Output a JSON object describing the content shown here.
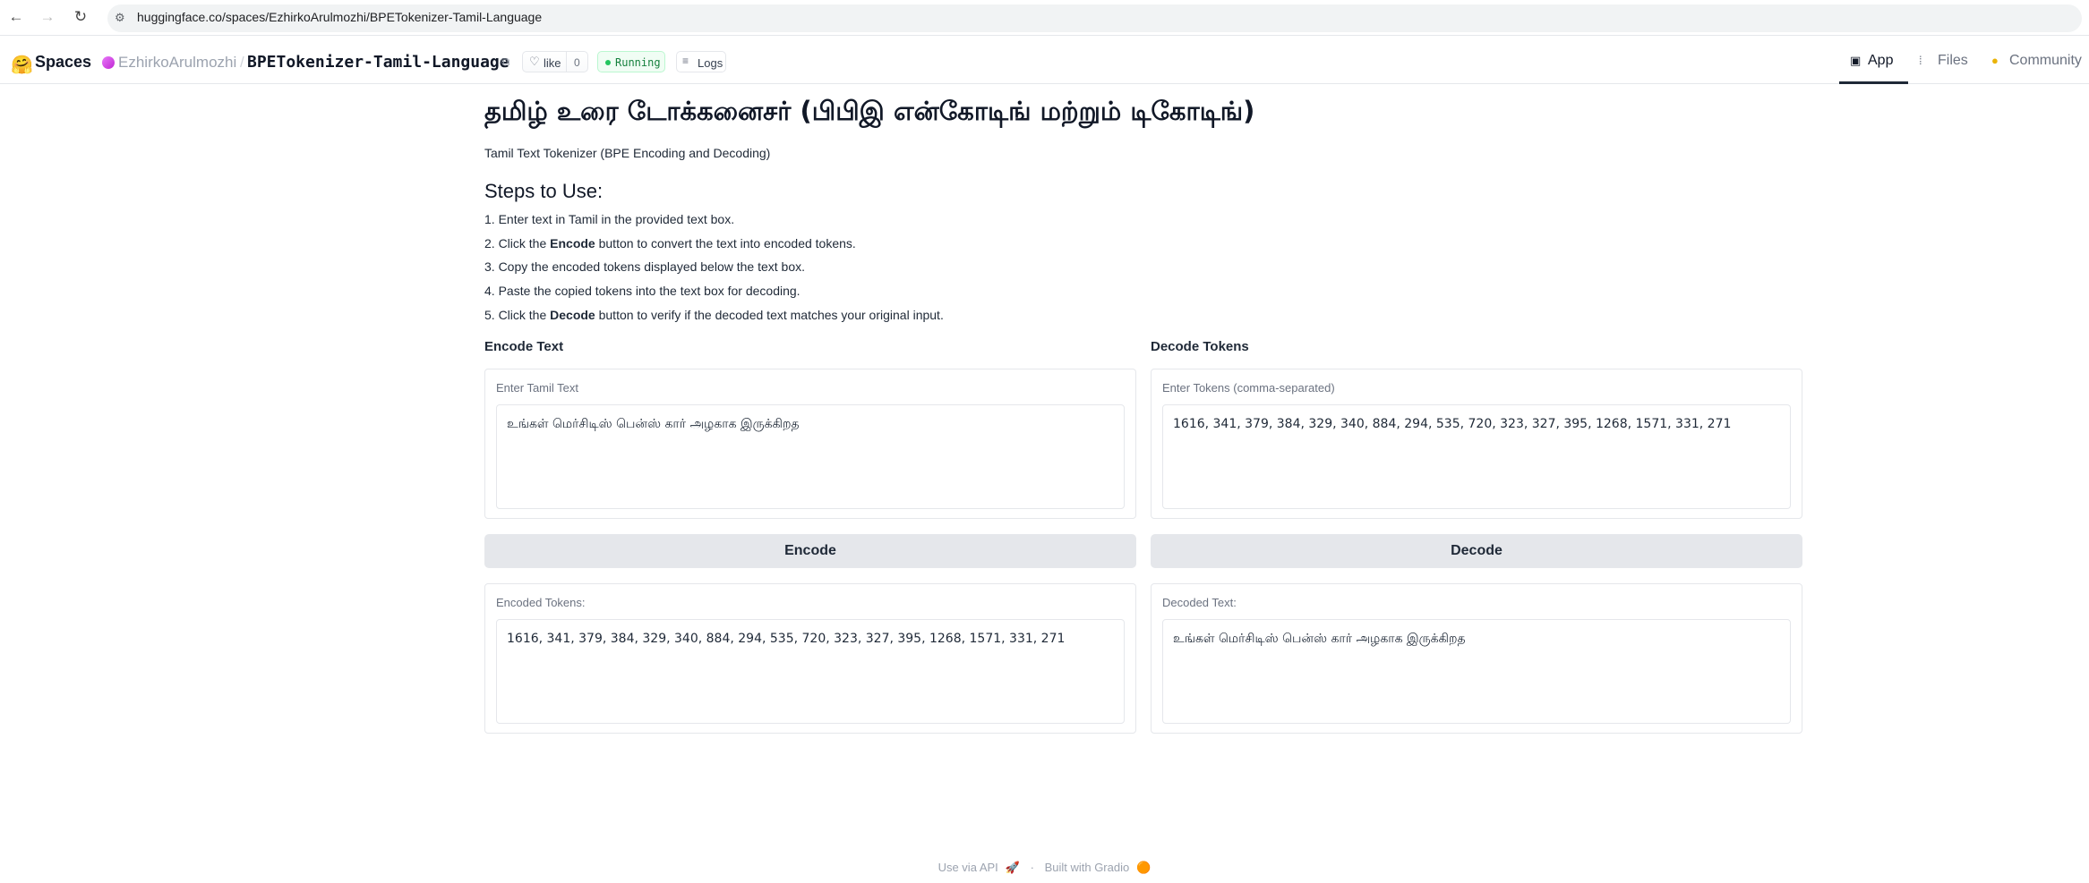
{
  "browser": {
    "url": "huggingface.co/spaces/EzhirkoArulmozhi/BPETokenizer-Tamil-Language"
  },
  "header": {
    "spaces_label": "Spaces",
    "user": "EzhirkoArulmozhi",
    "separator": "/",
    "repo": "BPETokenizer-Tamil-Language",
    "like_label": "like",
    "like_count": "0",
    "status": "Running",
    "logs_label": "Logs",
    "tabs": [
      {
        "label": "App"
      },
      {
        "label": "Files"
      },
      {
        "label": "Community"
      }
    ]
  },
  "main": {
    "title": "தமிழ் உரை டோக்கனைசர் (பிபிஇ என்கோடிங் மற்றும் டிகோடிங்)",
    "subtitle": "Tamil Text Tokenizer (BPE Encoding and Decoding)",
    "steps_heading": "Steps to Use:",
    "steps": [
      {
        "prefix": "1. Enter text in Tamil in the provided text box.",
        "bold": "",
        "suffix": ""
      },
      {
        "prefix": "2. Click the ",
        "bold": "Encode",
        "suffix": " button to convert the text into encoded tokens."
      },
      {
        "prefix": "3. Copy the encoded tokens displayed below the text box.",
        "bold": "",
        "suffix": ""
      },
      {
        "prefix": "4. Paste the copied tokens into the text box for decoding.",
        "bold": "",
        "suffix": ""
      },
      {
        "prefix": "5. Click the ",
        "bold": "Decode",
        "suffix": " button to verify if the decoded text matches your original input."
      }
    ]
  },
  "encode": {
    "section_label": "Encode Text",
    "input_label": "Enter Tamil Text",
    "input_value": "உங்கள் மெர்சிடிஸ் பென்ஸ் கார் அழகாக இருக்கிறத",
    "button_label": "Encode",
    "output_label": "Encoded Tokens:",
    "output_value": "1616, 341, 379, 384, 329, 340, 884, 294, 535, 720, 323, 327, 395, 1268, 1571, 331, 271"
  },
  "decode": {
    "section_label": "Decode Tokens",
    "input_label": "Enter Tokens (comma-separated)",
    "input_value": "1616, 341, 379, 384, 329, 340, 884, 294, 535, 720, 323, 327, 395, 1268, 1571, 331, 271",
    "button_label": "Decode",
    "output_label": "Decoded Text:",
    "output_value": "உங்கள் மெர்சிடிஸ் பென்ஸ் கார் அழகாக இருக்கிறத"
  },
  "footer": {
    "api_label": "Use via API",
    "separator": "·",
    "built_label": "Built with Gradio"
  },
  "colors": {
    "running": "#15803d",
    "button_bg": "#e5e7eb",
    "accent": "#111827"
  }
}
